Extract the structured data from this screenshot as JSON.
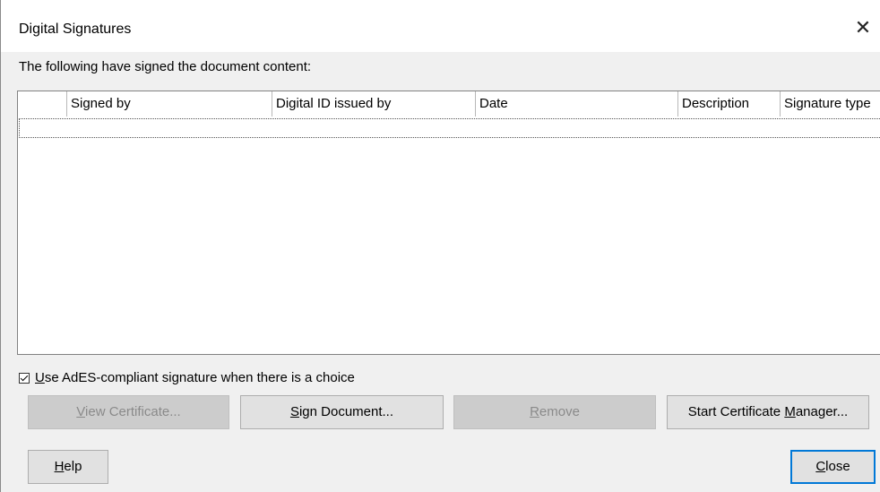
{
  "window": {
    "title": "Digital Signatures"
  },
  "signed_label": "The following have signed the document content:",
  "table": {
    "columns": [
      "",
      "Signed by",
      "Digital ID issued by",
      "Date",
      "Description",
      "Signature type"
    ],
    "rows": []
  },
  "checkbox": {
    "label": "Use AdES-compliant signature when there is a choice",
    "checked": true
  },
  "buttons": {
    "view_certificate": {
      "pre": "",
      "accel": "V",
      "post": "iew Certificate...",
      "enabled": false
    },
    "sign_document": {
      "pre": "",
      "accel": "S",
      "post": "ign Document...",
      "enabled": true
    },
    "remove": {
      "pre": "",
      "accel": "R",
      "post": "emove",
      "enabled": false
    },
    "start_cert_manager": {
      "pre": "Start Certificate ",
      "accel": "M",
      "post": "anager...",
      "enabled": true
    },
    "help": {
      "pre": "",
      "accel": "H",
      "post": "elp",
      "enabled": true
    },
    "close": {
      "pre": "",
      "accel": "C",
      "post": "lose",
      "enabled": true
    }
  },
  "icons": {
    "close": "close-icon",
    "checkbox": "checkbox-checked-icon"
  }
}
